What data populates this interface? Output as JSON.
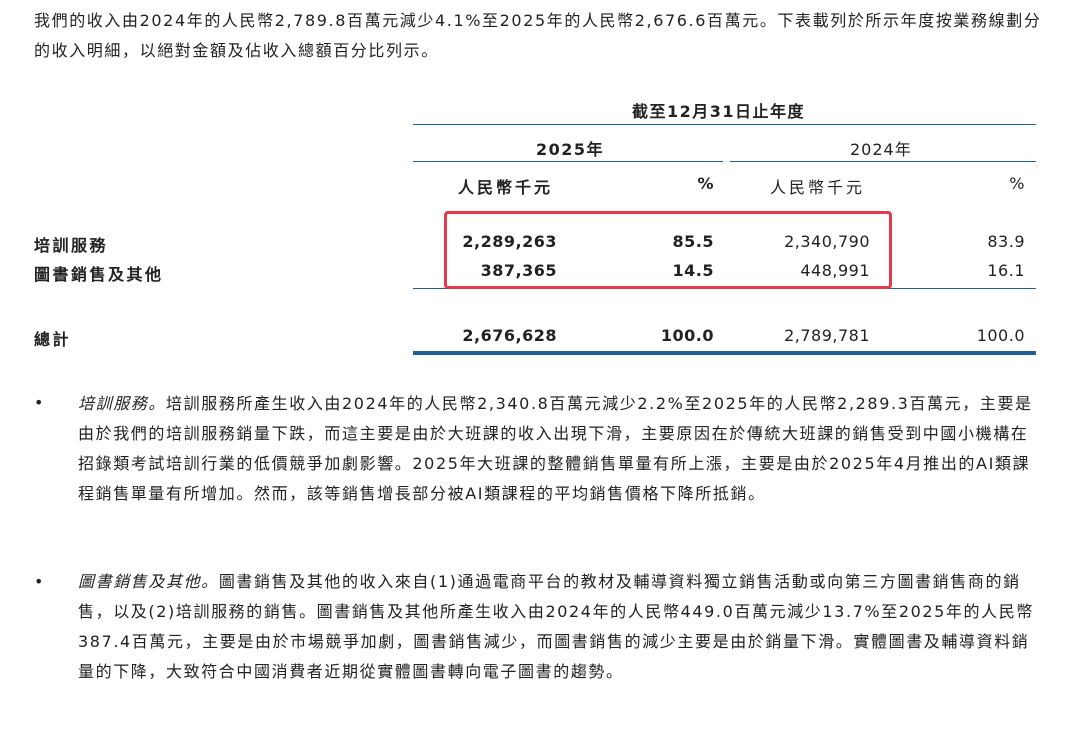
{
  "intro": "我們的收入由2024年的人民幣2,789.8百萬元減少4.1%至2025年的人民幣2,676.6百萬元。下表載列於所示年度按業務線劃分的收入明細，以絕對金額及佔收入總額百分比列示。",
  "table": {
    "period_header": "截至12月31日止年度",
    "year_current": "2025年",
    "year_prior": "2024年",
    "unit_current": "人民幣千元",
    "pct_current": "%",
    "unit_prior": "人民幣千元",
    "pct_prior": "%",
    "rows": [
      {
        "label": "培訓服務",
        "cur_amount": "2,289,263",
        "cur_pct": "85.5",
        "prior_amount": "2,340,790",
        "prior_pct": "83.9"
      },
      {
        "label": "圖書銷售及其他",
        "cur_amount": "387,365",
        "cur_pct": "14.5",
        "prior_amount": "448,991",
        "prior_pct": "16.1"
      }
    ],
    "total": {
      "label": "總計",
      "cur_amount": "2,676,628",
      "cur_pct": "100.0",
      "prior_amount": "2,789,781",
      "prior_pct": "100.0"
    },
    "highlight_color": "#e8394a",
    "rule_color": "#1f5f99"
  },
  "bullets": [
    {
      "marker": "•",
      "title": "培訓服務。",
      "text": "培訓服務所產生收入由2024年的人民幣2,340.8百萬元減少2.2%至2025年的人民幣2,289.3百萬元，主要是由於我們的培訓服務銷量下跌，而這主要是由於大班課的收入出現下滑，主要原因在於傳統大班課的銷售受到中國小機構在招錄類考試培訓行業的低價競爭加劇影響。2025年大班課的整體銷售單量有所上漲，主要是由於2025年4月推出的AI類課程銷售單量有所增加。然而，該等銷售增長部分被AI類課程的平均銷售價格下降所抵銷。"
    },
    {
      "marker": "•",
      "title": "圖書銷售及其他。",
      "text": "圖書銷售及其他的收入來自(1)通過電商平台的教材及輔導資料獨立銷售活動或向第三方圖書銷售商的銷售，以及(2)培訓服務的銷售。圖書銷售及其他所產生收入由2024年的人民幣449.0百萬元減少13.7%至2025年的人民幣387.4百萬元，主要是由於市場競爭加劇，圖書銷售減少，而圖書銷售的減少主要是由於銷量下滑。實體圖書及輔導資料銷量的下降，大致符合中國消費者近期從實體圖書轉向電子圖書的趨勢。"
    }
  ]
}
